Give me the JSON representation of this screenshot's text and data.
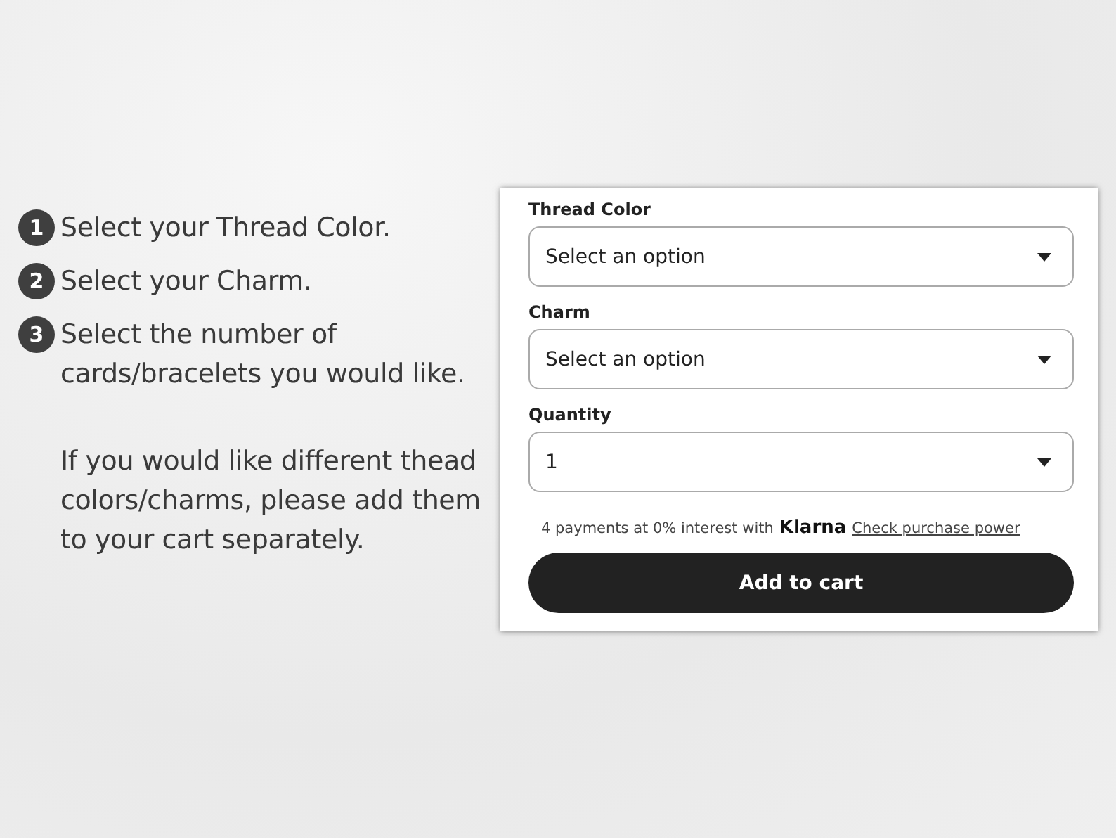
{
  "steps": [
    {
      "number": "1",
      "text": "Select your Thread Color."
    },
    {
      "number": "2",
      "text": "Select your Charm."
    },
    {
      "number": "3",
      "text": "Select the number of cards/bracelets you would like."
    }
  ],
  "note": "If you would like different thead colors/charms, please add them to your cart separately.",
  "form": {
    "fields": [
      {
        "label": "Thread Color",
        "value": "Select an option"
      },
      {
        "label": "Charm",
        "value": "Select an option"
      },
      {
        "label": "Quantity",
        "value": "1"
      }
    ],
    "payment_text": "4 payments at 0% interest with",
    "payment_brand": "Klarna",
    "payment_link": "Check purchase power",
    "button": "Add to cart"
  }
}
